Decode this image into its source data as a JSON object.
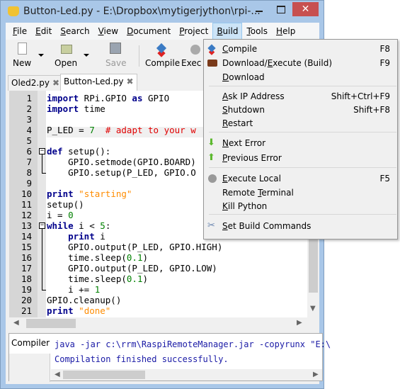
{
  "window": {
    "title": "Button-Led.py - E:\\Dropbox\\mytigerjython\\rpi-...",
    "close": "✕"
  },
  "menubar": [
    "File",
    "Edit",
    "Search",
    "View",
    "Document",
    "Project",
    "Build",
    "Tools",
    "Help"
  ],
  "toolbar": {
    "new": "New",
    "open": "Open",
    "save": "Save",
    "compile": "Compile",
    "execute": "Exec"
  },
  "tabs": [
    {
      "label": "Oled2.py"
    },
    {
      "label": "Button-Led.py"
    }
  ],
  "editor": {
    "lines": [
      "import RPi.GPIO as GPIO",
      "import time",
      "",
      "P_LED = 7  # adapt to your w",
      "",
      "def setup():",
      "    GPIO.setmode(GPIO.BOARD)",
      "    GPIO.setup(P_LED, GPIO.O",
      "",
      "print \"starting\"",
      "setup()",
      "i = 0",
      "while i < 5:",
      "    print i",
      "    GPIO.output(P_LED, GPIO.HIGH)",
      "    time.sleep(0.1)",
      "    GPIO.output(P_LED, GPIO.LOW)",
      "    time.sleep(0.1)",
      "    i += 1",
      "GPIO.cleanup()",
      "print \"done\""
    ]
  },
  "bottom": {
    "tab": "Compiler",
    "lines": [
      "java -jar c:\\rrm\\RaspiRemoteManager.jar -copyrunx \"E:\\",
      "Compilation finished successfully."
    ]
  },
  "build_menu": {
    "items": [
      {
        "label": "Compile",
        "u": 0,
        "key": "F8",
        "icon": "compile-icon"
      },
      {
        "label": "Download/Execute (Build)",
        "u": 9,
        "key": "F9",
        "icon": "brick-icon"
      },
      {
        "label": "Download",
        "u": 0,
        "key": ""
      },
      {
        "label": "Ask IP Address",
        "u": 0,
        "key": "Shift+Ctrl+F9"
      },
      {
        "label": "Shutdown",
        "u": 0,
        "key": "Shift+F8"
      },
      {
        "label": "Restart",
        "u": 0,
        "key": ""
      },
      {
        "label": "Next Error",
        "u": 0,
        "key": "",
        "icon": "arrow-down-icon"
      },
      {
        "label": "Previous Error",
        "u": 0,
        "key": "",
        "icon": "arrow-up-icon"
      },
      {
        "label": "Execute Local",
        "u": 0,
        "key": "F5",
        "icon": "gears-icon"
      },
      {
        "label": "Remote Terminal",
        "u": 7,
        "key": ""
      },
      {
        "label": "Kill Python",
        "u": 0,
        "key": ""
      },
      {
        "label": "Set Build Commands",
        "u": 0,
        "key": "",
        "icon": "tools-icon"
      }
    ]
  },
  "colors": {
    "frame": "#a9c7e8",
    "close": "#c75050",
    "keyword": "#00008b",
    "string": "#ff8c00",
    "comment": "#e00000",
    "number": "#008000",
    "output": "#1a1aa6"
  }
}
